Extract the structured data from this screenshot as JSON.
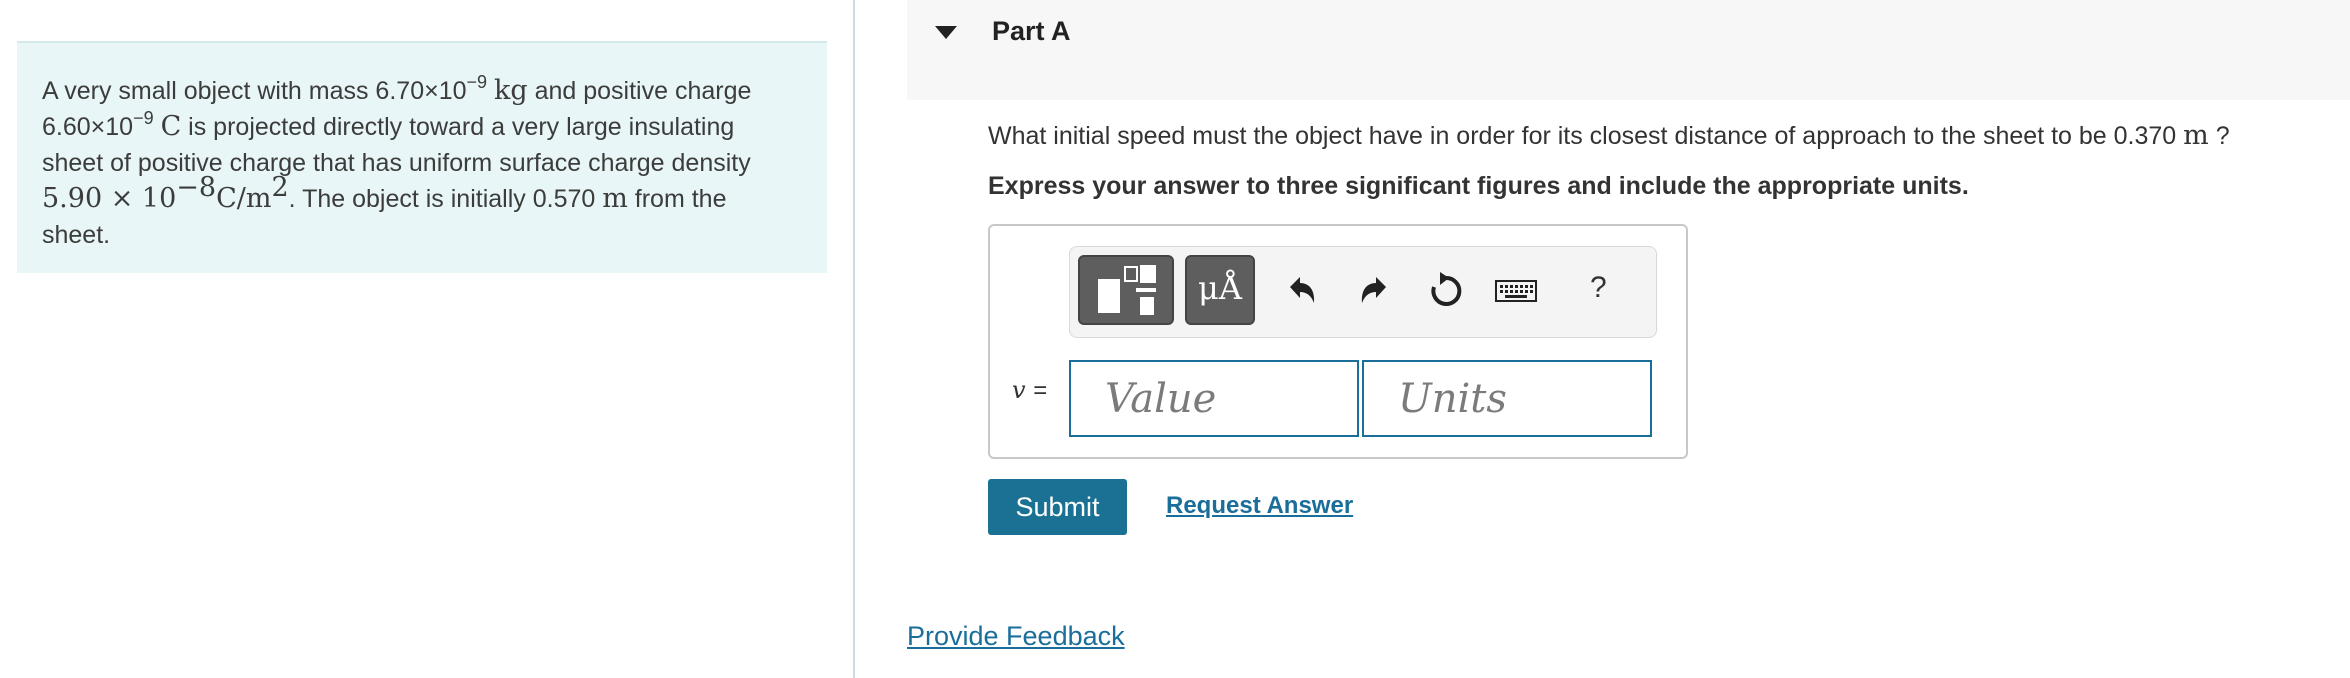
{
  "problem": {
    "t1": "A very small object with mass 6.70×10",
    "e1": "−9",
    "u1": "kg",
    "t2": " and positive charge",
    "t3": "6.60×10",
    "e3": "−9",
    "u3": "C",
    "t4": " is projected directly toward a very large insulating",
    "t5": "sheet of positive charge that has uniform surface charge density",
    "m5": "5.90 × 10",
    "e5": "−8",
    "u5": "C/m",
    "e5b": "2",
    "t6": ". The object is initially 0.570 ",
    "u6": "m",
    "t7": " from the",
    "t8": "sheet."
  },
  "part": {
    "title": "Part A",
    "question_prefix": "What initial speed must the object have in order for its closest distance of approach to the sheet to be 0.370 ",
    "question_unit": "m",
    "question_suffix": " ?",
    "instruction": "Express your answer to three significant figures and include the appropriate units."
  },
  "toolbar": {
    "symbols_label": "μÅ",
    "help_label": "?",
    "icons": [
      "templates-icon",
      "symbols-icon",
      "undo-icon",
      "redo-icon",
      "reset-icon",
      "keyboard-icon",
      "help-icon"
    ]
  },
  "answer": {
    "variable": "v",
    "equals": "=",
    "value_placeholder": "Value",
    "units_placeholder": "Units"
  },
  "actions": {
    "submit": "Submit",
    "request_answer": "Request Answer",
    "feedback": "Provide Feedback"
  },
  "colors": {
    "problem_bg": "#e8f6f7",
    "accent": "#1a7193",
    "link": "#1a6e9a"
  }
}
